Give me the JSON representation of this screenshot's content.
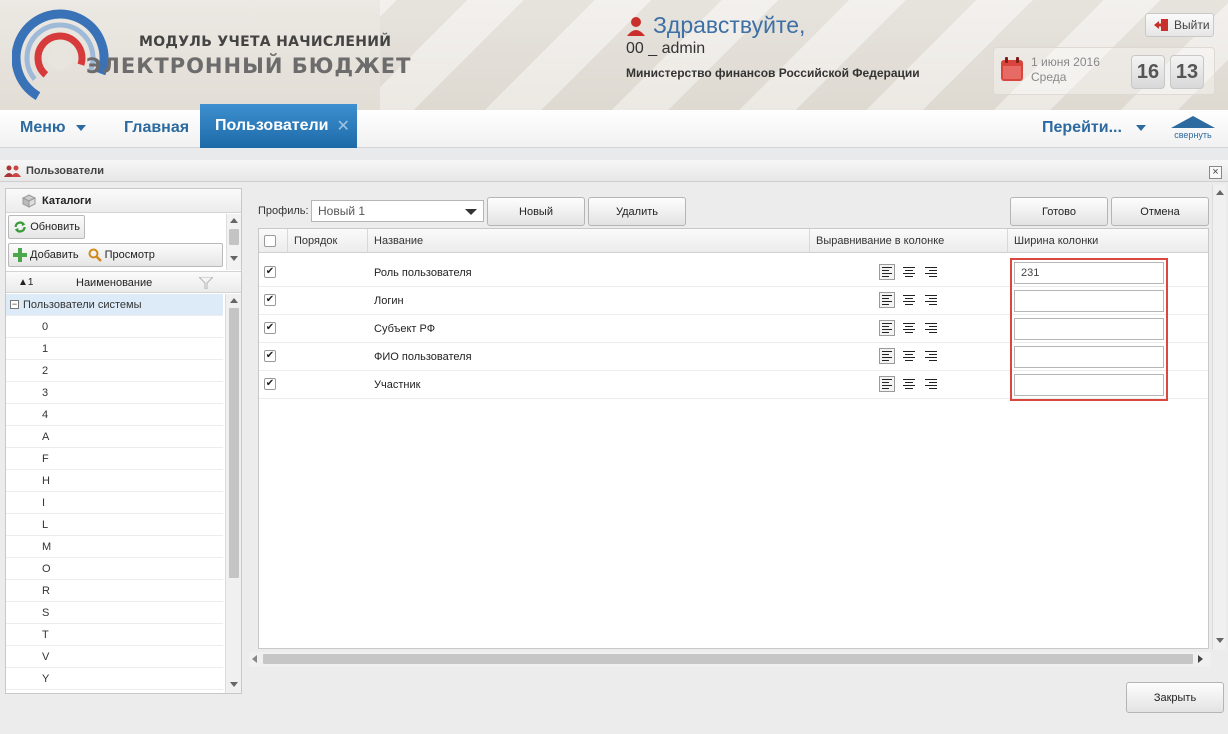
{
  "header": {
    "logo_line1": "МОДУЛЬ УЧЕТА НАЧИСЛЕНИЙ",
    "logo_line2": "ЭЛЕКТРОННЫЙ БЮДЖЕТ",
    "greeting": "Здравствуйте,",
    "username": "00 _ admin",
    "ministry": "Министерство финансов Российской Федерации",
    "logout_label": "Выйти",
    "date": "1 июня 2016",
    "weekday": "Среда",
    "hours": "16",
    "minutes": "13"
  },
  "nav": {
    "menu_label": "Меню",
    "home_label": "Главная",
    "active_tab_label": "Пользователи",
    "goto_label": "Перейти...",
    "collapse_label": "свернуть"
  },
  "window": {
    "title": "Пользователи"
  },
  "catalog": {
    "title": "Каталоги",
    "refresh_label": "Обновить",
    "add_label": "Добавить",
    "view_label": "Просмотр",
    "column_header": "Наименование",
    "sort_indicator": "▲1",
    "group_label": "Пользователи системы",
    "items": [
      "0",
      "1",
      "2",
      "3",
      "4",
      "A",
      "F",
      "H",
      "I",
      "L",
      "M",
      "O",
      "R",
      "S",
      "T",
      "V",
      "Y"
    ]
  },
  "profile": {
    "label": "Профиль:",
    "selected": "Новый 1",
    "new_label": "Новый",
    "delete_label": "Удалить",
    "done_label": "Готово",
    "cancel_label": "Отмена"
  },
  "grid": {
    "headers": {
      "order": "Порядок",
      "name": "Название",
      "alignment": "Выравнивание в колонке",
      "width": "Ширина колонки"
    },
    "rows": [
      {
        "name": "Роль пользователя",
        "checked": true,
        "width": "231"
      },
      {
        "name": "Логин",
        "checked": true,
        "width": ""
      },
      {
        "name": "Субъект РФ",
        "checked": true,
        "width": ""
      },
      {
        "name": "ФИО пользователя",
        "checked": true,
        "width": ""
      },
      {
        "name": "Участник",
        "checked": true,
        "width": ""
      }
    ]
  },
  "footer": {
    "close_label": "Закрыть"
  },
  "colors": {
    "accent": "#2c6aa0",
    "active_tab": "#2b7cbd",
    "highlight": "#d9473f",
    "greeting": "#3e6fa5"
  }
}
